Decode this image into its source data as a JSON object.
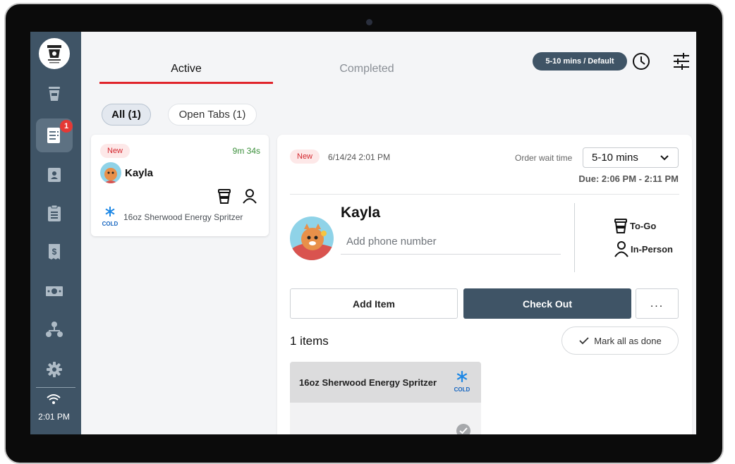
{
  "sidebar": {
    "logo_icon": "coffee-shop-logo",
    "items": [
      {
        "name": "cup",
        "icon": "coffee-cup-icon"
      },
      {
        "name": "orders",
        "icon": "orders-icon",
        "badge": "1",
        "active": true
      },
      {
        "name": "customers",
        "icon": "contact-card-icon"
      },
      {
        "name": "clipboard",
        "icon": "clipboard-icon"
      },
      {
        "name": "receipts",
        "icon": "receipt-icon"
      },
      {
        "name": "cash",
        "icon": "cash-icon"
      },
      {
        "name": "organization",
        "icon": "org-chart-icon"
      },
      {
        "name": "settings",
        "icon": "gear-icon"
      }
    ],
    "time": "2:01 PM"
  },
  "header": {
    "tabs": [
      {
        "label": "Active",
        "active": true
      },
      {
        "label": "Completed",
        "active": false
      }
    ],
    "wait_pill": "5-10 mins / Default"
  },
  "filters": {
    "all": "All (1)",
    "open_tabs": "Open Tabs (1)"
  },
  "order_card": {
    "status": "New",
    "timer": "9m 34s",
    "customer": "Kayla",
    "cold_label": "COLD",
    "item": "16oz Sherwood Energy Spritzer"
  },
  "detail": {
    "status": "New",
    "date": "6/14/24 2:01 PM",
    "wait_label": "Order wait time",
    "wait_value": "5-10 mins",
    "due": "Due: 2:06 PM - 2:11 PM",
    "customer": "Kayla",
    "phone_placeholder": "Add phone number",
    "to_go": "To-Go",
    "in_person": "In-Person",
    "add_item": "Add Item",
    "check_out": "Check Out",
    "more": "...",
    "count": "1 items",
    "mark_done": "Mark all as done",
    "items": [
      {
        "name": "16oz Sherwood Energy Spritzer",
        "temp": "COLD"
      }
    ]
  },
  "colors": {
    "sidebar": "#3f5466",
    "accent": "#e0242b",
    "checkout": "#3f5466",
    "new_badge": "#fde8e8",
    "timer": "#3a8f3a",
    "cold": "#1565c0"
  }
}
